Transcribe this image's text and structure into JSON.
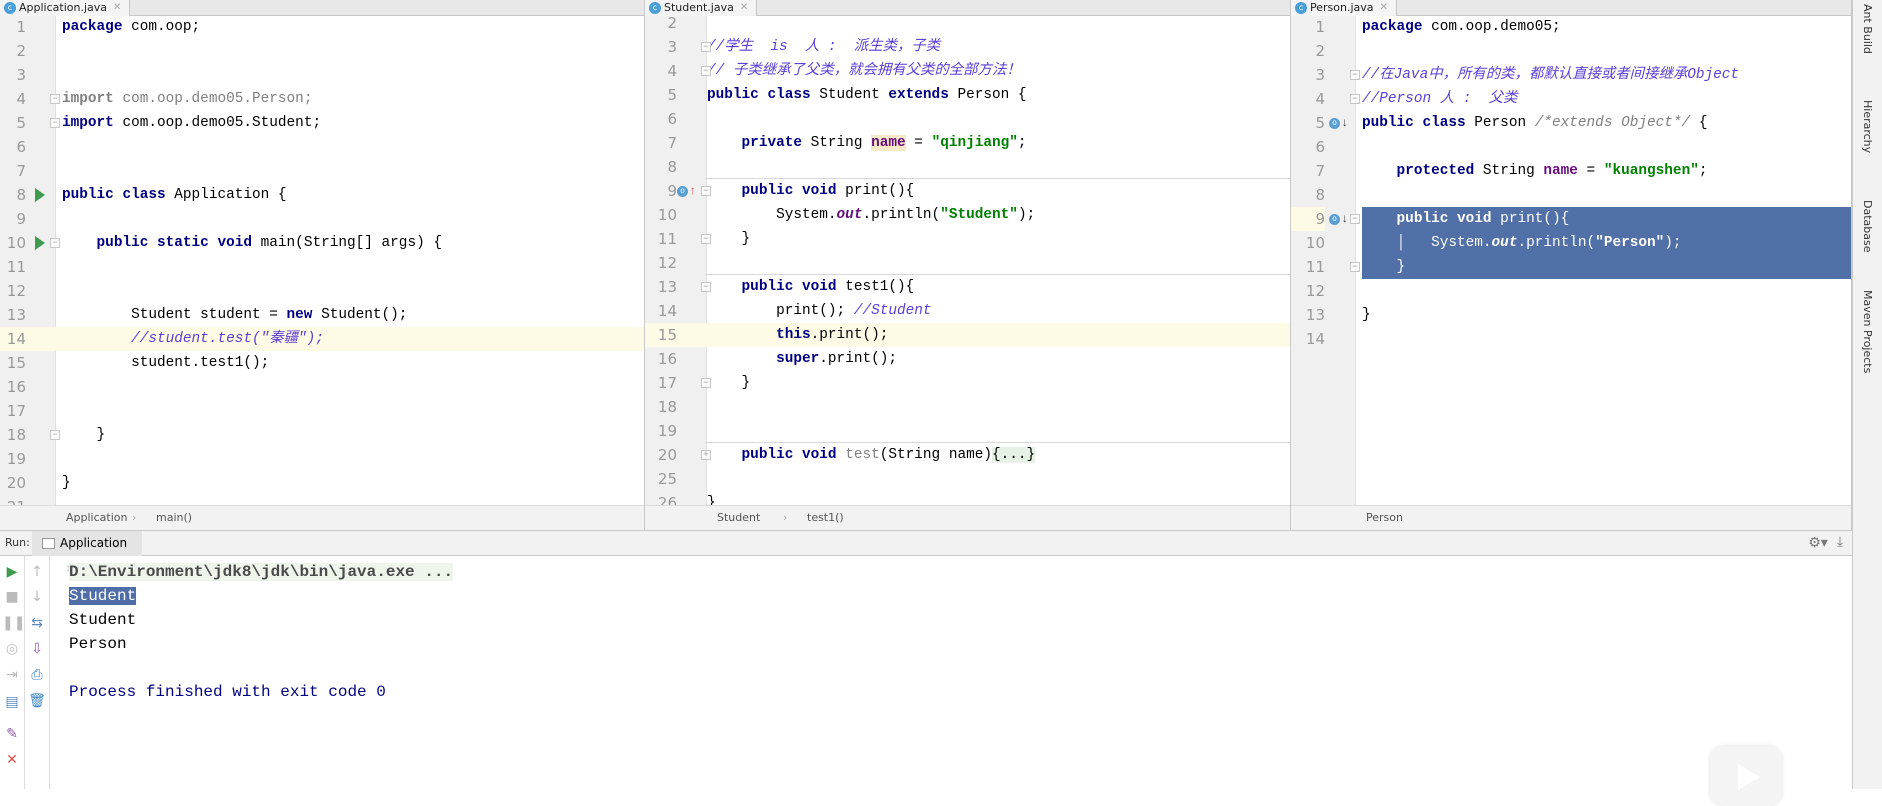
{
  "panes": [
    {
      "tab": "Application.java",
      "crumbs": [
        "Application",
        "main()"
      ],
      "lines": [
        {
          "n": "1",
          "seg": [
            [
              "k",
              "package"
            ],
            [
              "p",
              " com.oop;"
            ]
          ]
        },
        {
          "n": "2",
          "seg": []
        },
        {
          "n": "3",
          "seg": []
        },
        {
          "n": "4",
          "seg": [
            [
              "gk",
              "import"
            ],
            [
              "g",
              " com.oop.demo05.Person;"
            ]
          ]
        },
        {
          "n": "5",
          "seg": [
            [
              "k",
              "import"
            ],
            [
              "p",
              " com.oop.demo05.Student;"
            ]
          ]
        },
        {
          "n": "6",
          "seg": []
        },
        {
          "n": "7",
          "seg": []
        },
        {
          "n": "8",
          "seg": [
            [
              "k",
              "public class"
            ],
            [
              "p",
              " Application {"
            ]
          ]
        },
        {
          "n": "9",
          "seg": []
        },
        {
          "n": "10",
          "seg": [
            [
              "p",
              "    "
            ],
            [
              "k",
              "public static void"
            ],
            [
              "p",
              " main(String[] args) {"
            ]
          ]
        },
        {
          "n": "11",
          "seg": []
        },
        {
          "n": "12",
          "seg": []
        },
        {
          "n": "13",
          "seg": [
            [
              "p",
              "        Student student = "
            ],
            [
              "k",
              "new"
            ],
            [
              "p",
              " Student();"
            ]
          ]
        },
        {
          "n": "14",
          "cur": true,
          "seg": [
            [
              "p",
              "        "
            ],
            [
              "c",
              "//student.test(\"秦疆\");"
            ]
          ]
        },
        {
          "n": "15",
          "seg": [
            [
              "p",
              "        student.test1();"
            ]
          ]
        },
        {
          "n": "16",
          "seg": []
        },
        {
          "n": "17",
          "seg": []
        },
        {
          "n": "18",
          "seg": [
            [
              "p",
              "    }"
            ]
          ]
        },
        {
          "n": "19",
          "seg": []
        },
        {
          "n": "20",
          "seg": [
            [
              "p",
              "}"
            ]
          ]
        },
        {
          "n": "21",
          "seg": []
        }
      ]
    },
    {
      "tab": "Student.java",
      "crumbs": [
        "Student",
        "test1()"
      ],
      "lines": [
        {
          "n": "2",
          "seg": []
        },
        {
          "n": "3",
          "seg": [
            [
              "c",
              "//学生  is  人 :  派生类，子类"
            ]
          ]
        },
        {
          "n": "4",
          "seg": [
            [
              "c",
              "// 子类继承了父类，就会拥有父类的全部方法！"
            ]
          ]
        },
        {
          "n": "5",
          "seg": [
            [
              "k",
              "public class"
            ],
            [
              "p",
              " Student "
            ],
            [
              "k",
              "extends"
            ],
            [
              "p",
              " Person {"
            ]
          ]
        },
        {
          "n": "6",
          "seg": []
        },
        {
          "n": "7",
          "seg": [
            [
              "p",
              "    "
            ],
            [
              "k",
              "private"
            ],
            [
              "p",
              " String "
            ],
            [
              "fh",
              "name"
            ],
            [
              "p",
              " = "
            ],
            [
              "s",
              "\"qinjiang\""
            ],
            [
              "p",
              ";"
            ]
          ]
        },
        {
          "n": "8",
          "seg": []
        },
        {
          "n": "9",
          "sep": true,
          "seg": [
            [
              "p",
              "    "
            ],
            [
              "k",
              "public void"
            ],
            [
              "p",
              " print(){"
            ]
          ]
        },
        {
          "n": "10",
          "seg": [
            [
              "p",
              "        System."
            ],
            [
              "st",
              "out"
            ],
            [
              "p",
              ".println("
            ],
            [
              "s",
              "\"Student\""
            ],
            [
              "p",
              ");"
            ]
          ]
        },
        {
          "n": "11",
          "seg": [
            [
              "p",
              "    }"
            ]
          ]
        },
        {
          "n": "12",
          "seg": []
        },
        {
          "n": "13",
          "sep": true,
          "seg": [
            [
              "p",
              "    "
            ],
            [
              "k",
              "public void"
            ],
            [
              "p",
              " test1(){"
            ]
          ]
        },
        {
          "n": "14",
          "seg": [
            [
              "p",
              "        print(); "
            ],
            [
              "c",
              "//Student"
            ]
          ]
        },
        {
          "n": "15",
          "cur": true,
          "seg": [
            [
              "p",
              "        "
            ],
            [
              "k",
              "this"
            ],
            [
              "p",
              ".print();"
            ]
          ]
        },
        {
          "n": "16",
          "seg": [
            [
              "p",
              "        "
            ],
            [
              "k",
              "super"
            ],
            [
              "p",
              ".print();"
            ]
          ]
        },
        {
          "n": "17",
          "seg": [
            [
              "p",
              "    }"
            ]
          ]
        },
        {
          "n": "18",
          "seg": []
        },
        {
          "n": "19",
          "seg": []
        },
        {
          "n": "20",
          "sep": true,
          "seg": [
            [
              "p",
              "    "
            ],
            [
              "k",
              "public void"
            ],
            [
              "p",
              " "
            ],
            [
              "g",
              "test"
            ],
            [
              "p",
              "(String name)"
            ],
            [
              "cf",
              "{...}"
            ]
          ]
        },
        {
          "n": "25",
          "seg": []
        },
        {
          "n": "26",
          "seg": [
            [
              "p",
              "}"
            ]
          ]
        }
      ]
    },
    {
      "tab": "Person.java",
      "crumbs": [
        "Person"
      ],
      "lines": [
        {
          "n": "1",
          "seg": [
            [
              "k",
              "package"
            ],
            [
              "p",
              " com.oop.demo05;"
            ]
          ]
        },
        {
          "n": "2",
          "seg": []
        },
        {
          "n": "3",
          "seg": [
            [
              "c",
              "//在Java中，所有的类，都默认直接或者间接继承Object"
            ]
          ]
        },
        {
          "n": "4",
          "seg": [
            [
              "c",
              "//Person 人 :  父类"
            ]
          ]
        },
        {
          "n": "5",
          "seg": [
            [
              "k",
              "public class"
            ],
            [
              "p",
              " Person "
            ],
            [
              "gi",
              "/*extends Object*/"
            ],
            [
              "p",
              " {"
            ]
          ]
        },
        {
          "n": "6",
          "seg": []
        },
        {
          "n": "7",
          "seg": [
            [
              "p",
              "    "
            ],
            [
              "k",
              "protected"
            ],
            [
              "p",
              " String "
            ],
            [
              "f",
              "name"
            ],
            [
              "p",
              " = "
            ],
            [
              "s",
              "\"kuangshen\""
            ],
            [
              "p",
              ";"
            ]
          ]
        },
        {
          "n": "8",
          "seg": []
        },
        {
          "n": "9",
          "sel": true,
          "cur": true,
          "seg": [
            [
              "p",
              "    "
            ],
            [
              "k",
              "public void"
            ],
            [
              "p",
              " print(){"
            ]
          ]
        },
        {
          "n": "10",
          "sel": true,
          "seg": [
            [
              "p",
              "    │   System."
            ],
            [
              "st",
              "out"
            ],
            [
              "p",
              ".println("
            ],
            [
              "s",
              "\"Person\""
            ],
            [
              "p",
              ");"
            ]
          ]
        },
        {
          "n": "11",
          "sel": true,
          "seg": [
            [
              "p",
              "    }"
            ]
          ]
        },
        {
          "n": "12",
          "seg": []
        },
        {
          "n": "13",
          "seg": [
            [
              "p",
              "}"
            ]
          ]
        },
        {
          "n": "14",
          "seg": []
        }
      ]
    }
  ],
  "run": {
    "label": "Run:",
    "tab": "Application",
    "output": [
      {
        "text": "D:\\Environment\\jdk8\\jdk\\bin\\java.exe ...",
        "kind": "cmd"
      },
      {
        "text": "Student",
        "kind": "selected"
      },
      {
        "text": "Student",
        "kind": "out"
      },
      {
        "text": "Person",
        "kind": "out"
      },
      {
        "text": "",
        "kind": "out"
      },
      {
        "text": "Process finished with exit code 0",
        "kind": "exit"
      }
    ]
  },
  "side_tools": [
    "Ant Build",
    "Hierarchy",
    "Database",
    "Maven Projects"
  ],
  "colors": {
    "keyword": "#000080",
    "string": "#008000",
    "comment": "#5b3fd6",
    "selection": "#5170a8",
    "run_green": "#3f9a4d"
  }
}
